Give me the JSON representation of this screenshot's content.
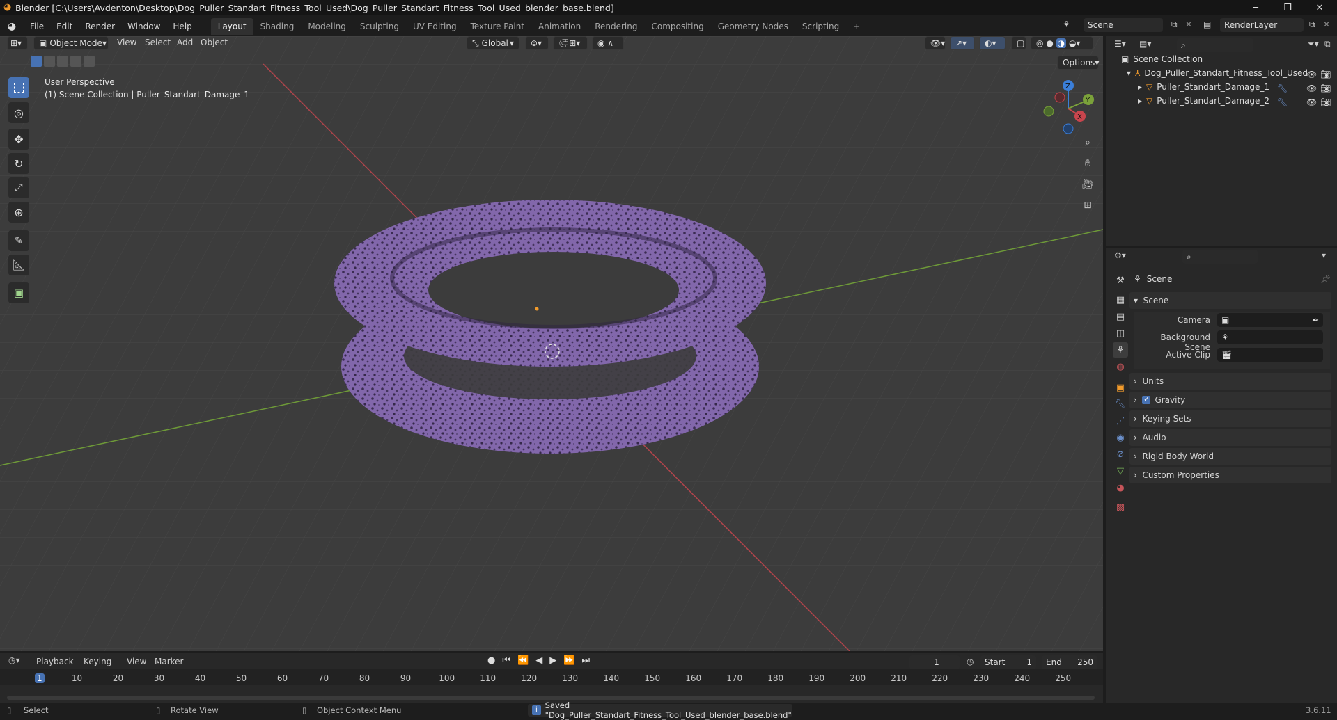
{
  "app": {
    "title": "Blender [C:\\Users\\Avdenton\\Desktop\\Dog_Puller_Standart_Fitness_Tool_Used\\Dog_Puller_Standart_Fitness_Tool_Used_blender_base.blend]",
    "version": "3.6.11"
  },
  "menus": [
    "File",
    "Edit",
    "Render",
    "Window",
    "Help"
  ],
  "workspaces": [
    "Layout",
    "Shading",
    "Modeling",
    "Sculpting",
    "UV Editing",
    "Texture Paint",
    "Animation",
    "Rendering",
    "Compositing",
    "Geometry Nodes",
    "Scripting"
  ],
  "active_workspace": "Layout",
  "scene_field": "Scene",
  "render_layer_field": "RenderLayer",
  "viewport": {
    "mode": "Object Mode",
    "menus": [
      "View",
      "Select",
      "Add",
      "Object"
    ],
    "orientation": "Global",
    "options_label": "Options",
    "perspective_label": "User Perspective",
    "collection_label": "(1) Scene Collection | Puller_Standart_Damage_1",
    "gizmo_axes": {
      "x": "X",
      "y": "Y",
      "z": "Z"
    }
  },
  "outliner": {
    "root": "Scene Collection",
    "collection": "Dog_Puller_Standart_Fitness_Tool_Used",
    "objects": [
      "Puller_Standart_Damage_1",
      "Puller_Standart_Damage_2"
    ]
  },
  "properties": {
    "header": "Scene",
    "section": "Scene",
    "fields": [
      {
        "label": "Camera",
        "value": ""
      },
      {
        "label": "Background Scene",
        "value": ""
      },
      {
        "label": "Active Clip",
        "value": ""
      }
    ],
    "panels": [
      "Units",
      "Gravity",
      "Keying Sets",
      "Audio",
      "Rigid Body World",
      "Custom Properties"
    ],
    "gravity_checked": true
  },
  "timeline": {
    "menus": [
      "Playback",
      "Keying",
      "View",
      "Marker"
    ],
    "current_frame": "1",
    "start_label": "Start",
    "start": "1",
    "end_label": "End",
    "end": "250",
    "ruler": [
      "1",
      "10",
      "20",
      "30",
      "40",
      "50",
      "60",
      "70",
      "80",
      "90",
      "100",
      "110",
      "120",
      "130",
      "140",
      "150",
      "160",
      "170",
      "180",
      "190",
      "200",
      "210",
      "220",
      "230",
      "240",
      "250"
    ]
  },
  "status": {
    "select": "Select",
    "rotate": "Rotate View",
    "context": "Object Context Menu",
    "message": "Saved \"Dog_Puller_Standart_Fitness_Tool_Used_blender_base.blend\""
  },
  "colors": {
    "accent": "#4772b3",
    "object_purple": "#7e63a6",
    "x_axis": "#c8454d",
    "y_axis": "#7ba23a"
  }
}
